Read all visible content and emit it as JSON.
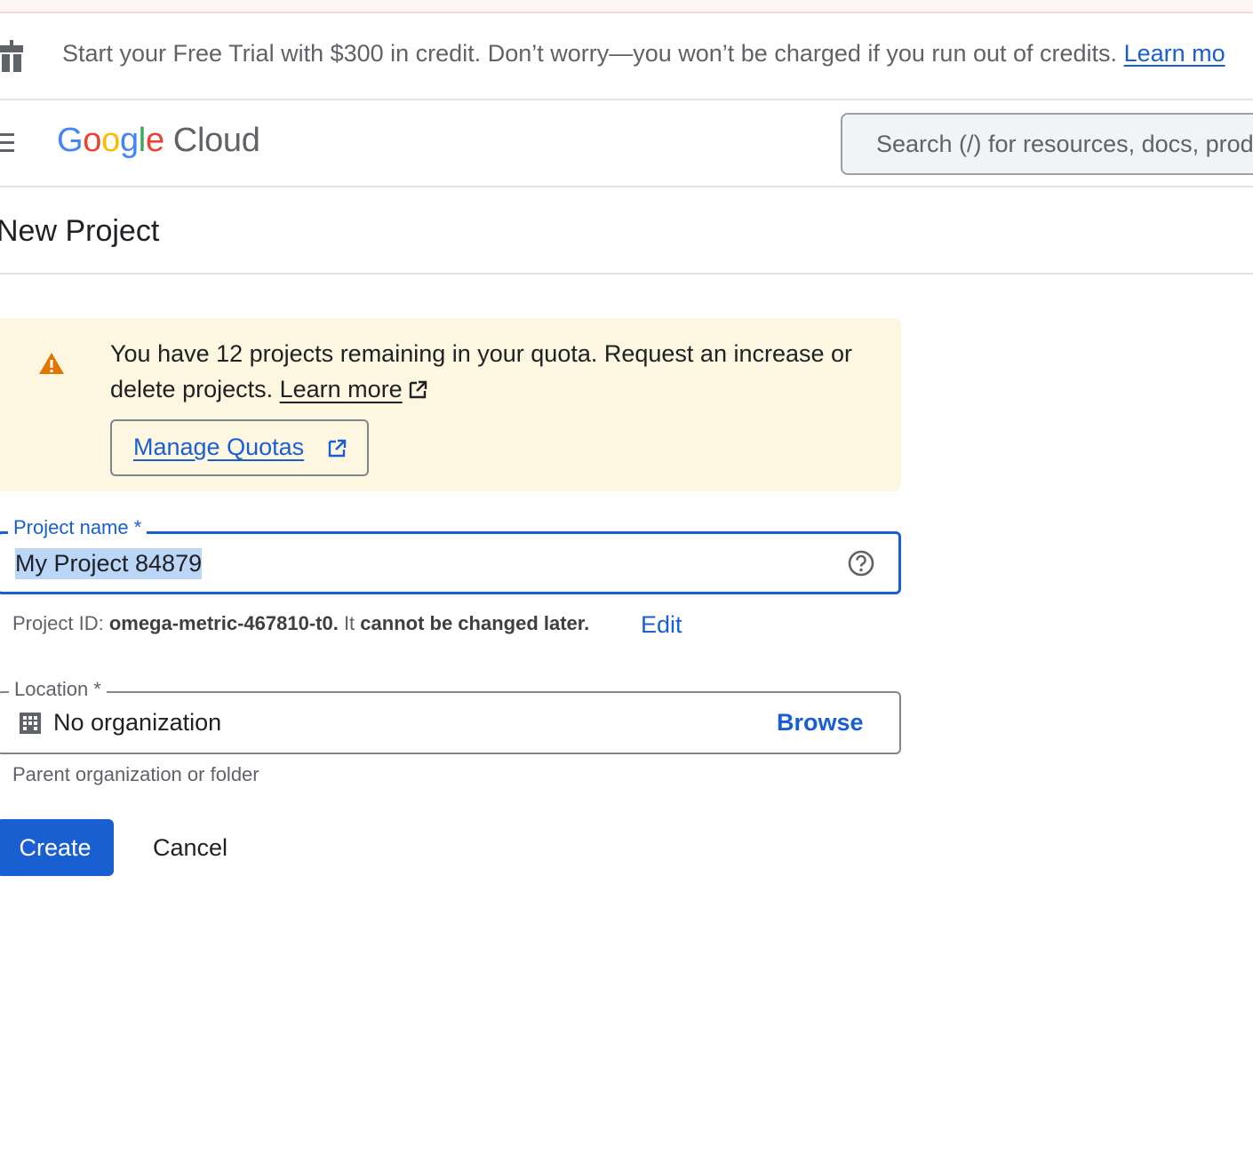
{
  "trial_banner": {
    "text": "Start your Free Trial with $300 in credit. Don’t worry—you won’t be charged if you run out of credits.",
    "link": "Learn mo"
  },
  "header": {
    "logo_google": [
      "G",
      "o",
      "o",
      "g",
      "l",
      "e"
    ],
    "logo_cloud": "Cloud",
    "search_placeholder": "Search (/) for resources, docs, prod"
  },
  "page": {
    "title": "New Project"
  },
  "quota_notice": {
    "text_line": "You have 12 projects remaining in your quota. Request an increase or delete projects.",
    "learn_more": "Learn more",
    "manage_quotas": "Manage Quotas"
  },
  "project_name": {
    "label": "Project name *",
    "value": "My Project 84879"
  },
  "project_id": {
    "prefix": "Project ID: ",
    "id": "omega-metric-467810-t0.",
    "middle": " It ",
    "suffix": "cannot be changed later.",
    "edit": "Edit"
  },
  "location": {
    "label": "Location *",
    "value": "No organization",
    "browse": "Browse",
    "helper": "Parent organization or folder"
  },
  "actions": {
    "create": "Create",
    "cancel": "Cancel"
  },
  "colors": {
    "primary": "#1a5fd1",
    "warning": "#e37400",
    "notice_bg": "#fdf6e0"
  }
}
